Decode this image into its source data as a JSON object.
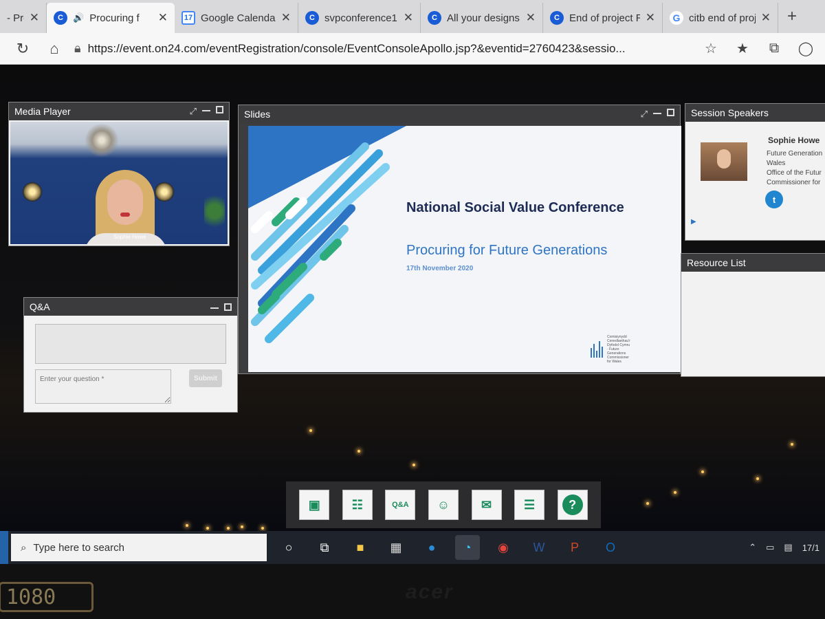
{
  "browser": {
    "tabs": [
      {
        "label": "- Proc",
        "favicon": "partial",
        "close": "✕"
      },
      {
        "label": "Procuring f",
        "favicon": "on24-icon",
        "audio": "🔊",
        "close": "✕"
      },
      {
        "label": "Google Calenda",
        "favicon": "calendar-icon",
        "favicon_text": "17",
        "close": "✕"
      },
      {
        "label": "svpconference1",
        "favicon": "on24-icon",
        "close": "✕"
      },
      {
        "label": "All your designs",
        "favicon": "canva-icon",
        "favicon_text": "C",
        "close": "✕"
      },
      {
        "label": "End of project R",
        "favicon": "canva-icon",
        "favicon_text": "C",
        "close": "✕"
      },
      {
        "label": "citb end of proj",
        "favicon": "google-icon",
        "favicon_text": "G",
        "close": "✕"
      }
    ],
    "new_tab": "+",
    "url": "https://event.on24.com/eventRegistration/console/EventConsoleApollo.jsp?&eventid=2760423&sessio..."
  },
  "console": {
    "media_player": {
      "title": "Media Player",
      "caption": "Sophie Howe"
    },
    "slides": {
      "title": "Slides",
      "slide_title": "National Social Value Conference",
      "slide_subtitle": "Procuring for Future Generations",
      "slide_date": "17th November 2020",
      "logo_text": "Comisiynydd Cenedlaethau'r Dyfodol Cymru · Future Generations Commissioner for Wales"
    },
    "qa": {
      "title": "Q&A",
      "placeholder": "Enter your question *",
      "submit": "Submit"
    },
    "speakers": {
      "title": "Session Speakers",
      "name": "Sophie Howe",
      "org_line1": "Future Generation",
      "org_line2": "Wales",
      "org_line3": "Office of the Futur",
      "org_line4": "Commissioner for"
    },
    "resources": {
      "title": "Resource List"
    },
    "dock": {
      "qa_label": "Q&A",
      "help_label": "?"
    }
  },
  "taskbar": {
    "search_placeholder": "Type here to search",
    "tray_text": "17/1"
  },
  "bezel": {
    "brand": "acer",
    "resolution_badge": "1080"
  }
}
